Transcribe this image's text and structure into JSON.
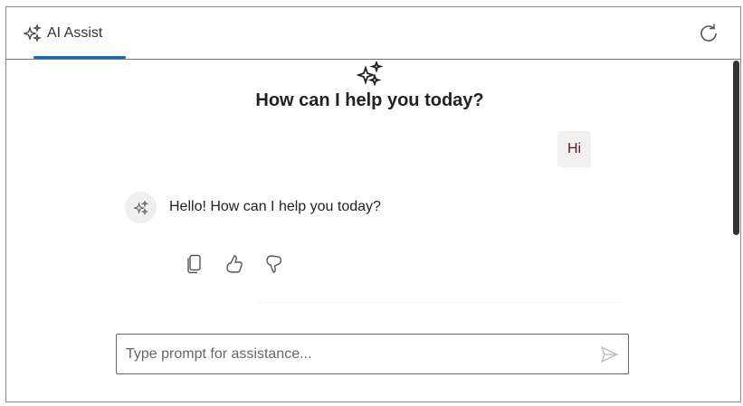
{
  "header": {
    "tab_label": "AI Assist"
  },
  "welcome": {
    "title": "How can I help you today?"
  },
  "messages": [
    {
      "role": "user",
      "text": "Hi"
    },
    {
      "role": "assistant",
      "text": "Hello! How can I help you today?"
    }
  ],
  "prompt": {
    "placeholder": "Type prompt for assistance...",
    "value": ""
  },
  "colors": {
    "accent": "#0f6cbd",
    "user_bubble": "#f2f1f0"
  }
}
